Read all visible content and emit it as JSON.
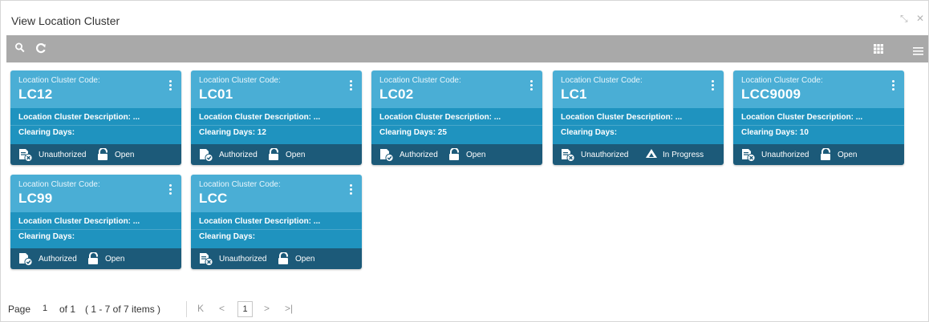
{
  "window": {
    "title": "View Location Cluster",
    "minimize_glyph": "⤡",
    "close_glyph": "✕"
  },
  "toolbar": {
    "search_icon": "search-icon",
    "refresh_icon": "refresh-icon",
    "grid_view_icon": "grid-view-icon",
    "list_view_icon": "list-view-icon"
  },
  "card_labels": {
    "code_label": "Location Cluster Code:",
    "description_label": "Location Cluster Description:  ...",
    "clearing_days_label": "Clearing Days:"
  },
  "cards": [
    {
      "code": "LC12",
      "clearing_days": "",
      "auth_status": "Unauthorized",
      "auth_icon": "unauthorized-icon",
      "record_status": "Open",
      "record_icon": "open-lock-icon"
    },
    {
      "code": "LC01",
      "clearing_days": "12",
      "auth_status": "Authorized",
      "auth_icon": "authorized-icon",
      "record_status": "Open",
      "record_icon": "open-lock-icon"
    },
    {
      "code": "LC02",
      "clearing_days": "25",
      "auth_status": "Authorized",
      "auth_icon": "authorized-icon",
      "record_status": "Open",
      "record_icon": "open-lock-icon"
    },
    {
      "code": "LC1",
      "clearing_days": "",
      "auth_status": "Unauthorized",
      "auth_icon": "unauthorized-icon",
      "record_status": "In Progress",
      "record_icon": "in-progress-icon"
    },
    {
      "code": "LCC9009",
      "clearing_days": "10",
      "auth_status": "Unauthorized",
      "auth_icon": "unauthorized-icon",
      "record_status": "Open",
      "record_icon": "open-lock-icon"
    },
    {
      "code": "LC99",
      "clearing_days": "",
      "auth_status": "Authorized",
      "auth_icon": "authorized-icon",
      "record_status": "Open",
      "record_icon": "open-lock-icon"
    },
    {
      "code": "LCC",
      "clearing_days": "",
      "auth_status": "Unauthorized",
      "auth_icon": "unauthorized-icon",
      "record_status": "Open",
      "record_icon": "open-lock-icon"
    }
  ],
  "pager": {
    "page_label": "Page",
    "page_value": "1",
    "of_label": "of 1",
    "items_label": "( 1 - 7 of 7 items )",
    "current_page": "1",
    "first_glyph": "K",
    "prev_glyph": "<",
    "next_glyph": ">",
    "last_glyph": ">|"
  },
  "colors": {
    "card_header": "#4aaed5",
    "card_body": "#1f93bf",
    "card_footer": "#1c5a79",
    "toolbar": "#a9a9a9"
  }
}
